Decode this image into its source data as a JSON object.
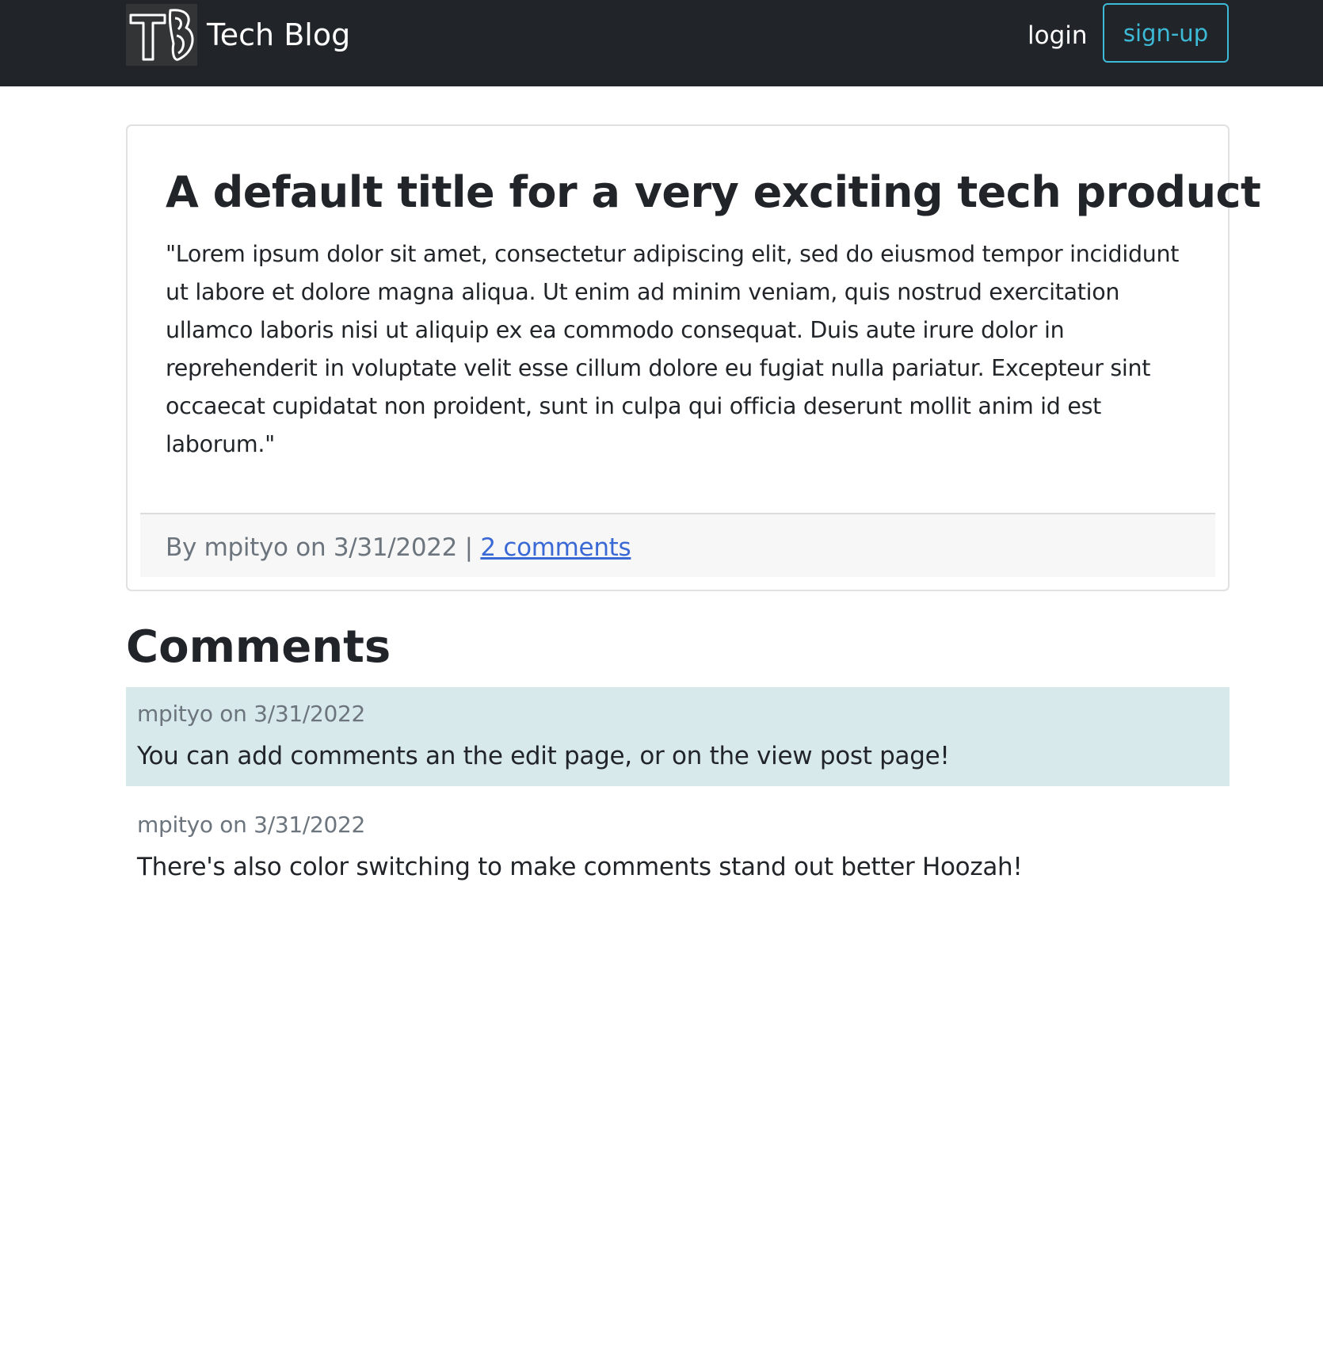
{
  "navbar": {
    "logo_icon": "tb-logo-icon",
    "brand_title": "Tech Blog",
    "login_label": "login",
    "signup_label": "sign-up"
  },
  "post": {
    "title": "A default title for a very exciting tech product",
    "body": "\"Lorem ipsum dolor sit amet, consectetur adipiscing elit, sed do eiusmod tempor incididunt ut labore et dolore magna aliqua. Ut enim ad minim veniam, quis nostrud exercitation ullamco laboris nisi ut aliquip ex ea commodo consequat. Duis aute irure dolor in reprehenderit in voluptate velit esse cillum dolore eu fugiat nulla pariatur. Excepteur sint occaecat cupidatat non proident, sunt in culpa qui officia deserunt mollit anim id est laborum.\"",
    "meta_prefix": "By mpityo on 3/31/2022 | ",
    "comments_link": "2 comments"
  },
  "comments": {
    "heading": "Comments",
    "items": [
      {
        "meta": "mpityo on 3/31/2022",
        "text": "You can add comments an the edit page, or on the view post page!"
      },
      {
        "meta": "mpityo on 3/31/2022",
        "text": "There's also color switching to make comments stand out better Hoozah!"
      }
    ]
  },
  "colors": {
    "navbar_bg": "#212529",
    "signup_accent": "#3dbad7",
    "link": "#3a69d6",
    "comment_highlight": "#d8e9eb",
    "muted_text": "#6c757d"
  }
}
